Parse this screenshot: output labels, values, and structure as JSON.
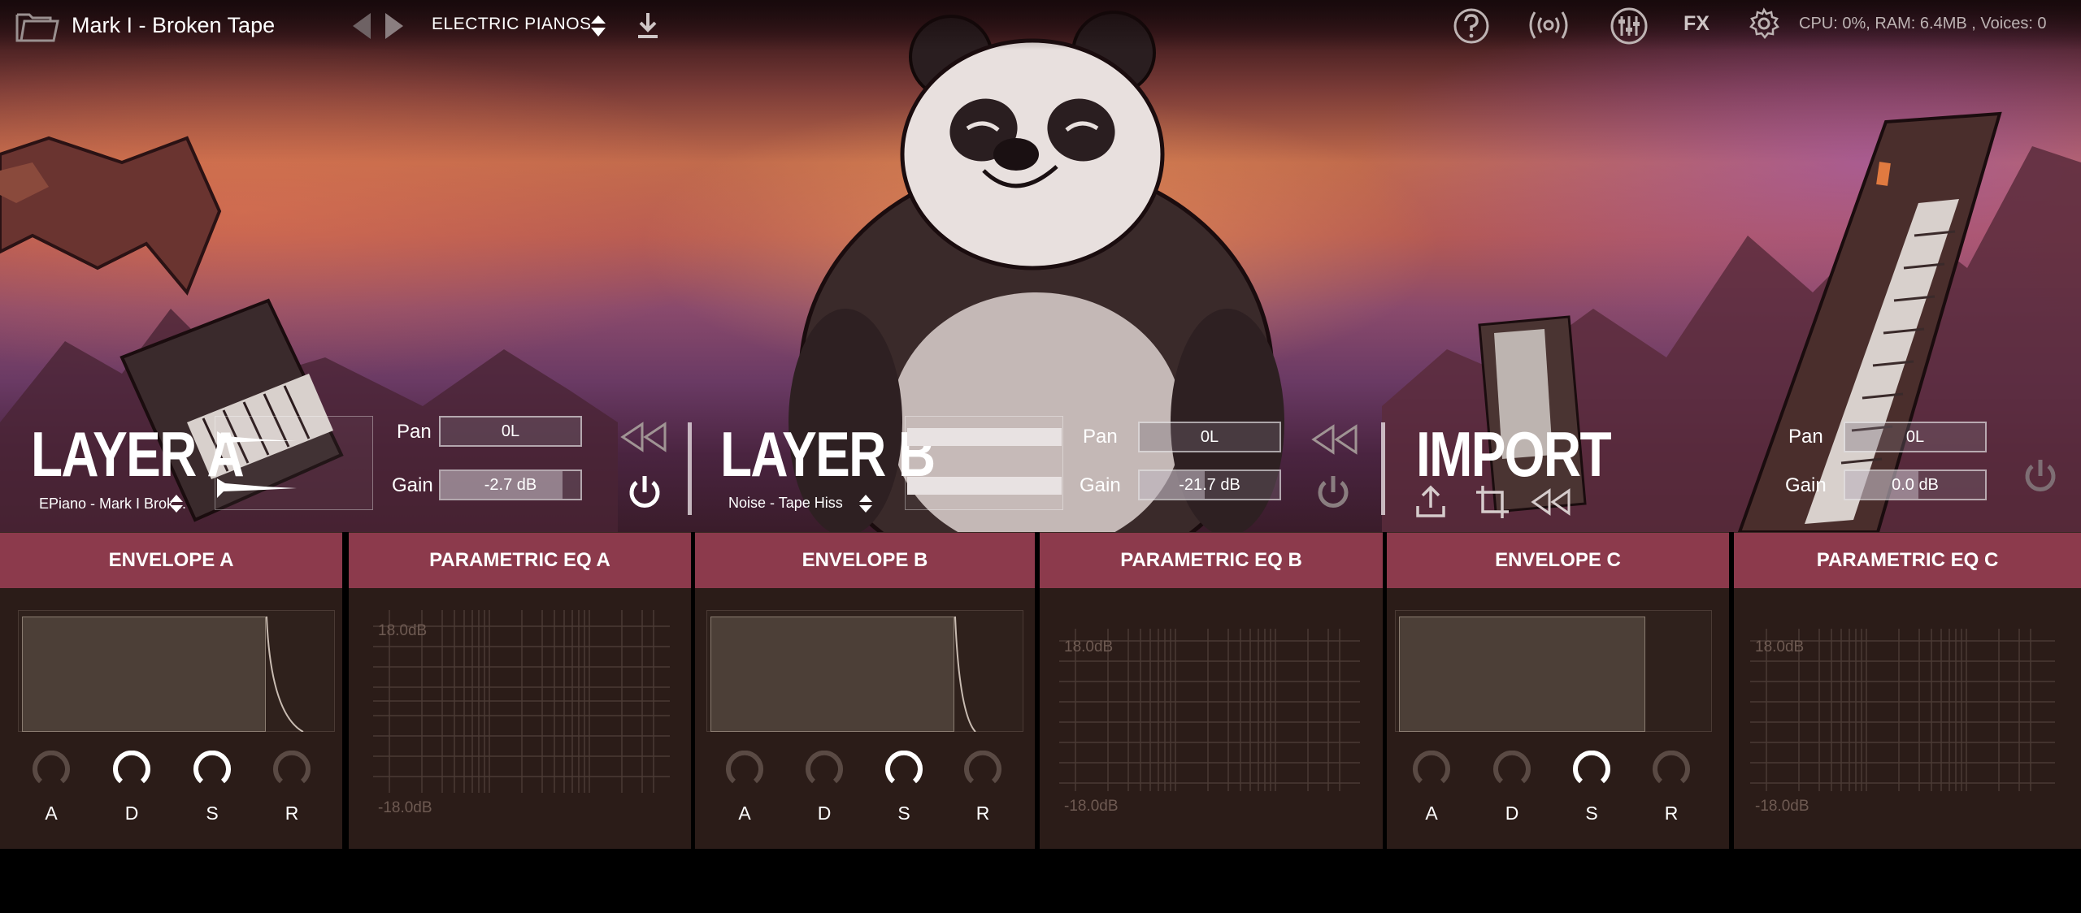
{
  "top_bar": {
    "preset_name": "Mark I - Broken Tape",
    "bank_name": "ELECTRIC PIANOS",
    "fx_label": "FX",
    "stats": "CPU: 0%, RAM: 6.4MB , Voices: 0",
    "icons": [
      "folder-icon",
      "prev-arrow-icon",
      "next-arrow-icon",
      "bank-updown-icon",
      "download-icon",
      "help-icon",
      "broadcast-icon",
      "mixer-icon",
      "fx-icon",
      "gear-icon"
    ]
  },
  "layer_a": {
    "title": "LAYER A",
    "sample": "EPiano - Mark I Brok...",
    "pan_label": "Pan",
    "pan_value": "0L",
    "gain_label": "Gain",
    "gain_value": "-2.7 dB"
  },
  "layer_b": {
    "title": "LAYER B",
    "sample": "Noise - Tape Hiss",
    "pan_label": "Pan",
    "pan_value": "0L",
    "gain_label": "Gain",
    "gain_value": "-21.7 dB"
  },
  "import": {
    "title": "IMPORT",
    "pan_label": "Pan",
    "pan_value": "0L",
    "gain_label": "Gain",
    "gain_value": "0.0 dB"
  },
  "panels": [
    {
      "title": "ENVELOPE A",
      "type": "envelope",
      "knobs": [
        "A",
        "D",
        "S",
        "R"
      ],
      "active_knobs": [
        false,
        true,
        true,
        false
      ]
    },
    {
      "title": "PARAMETRIC EQ A",
      "type": "eq",
      "top_label": "18.0dB",
      "bottom_label": "-18.0dB"
    },
    {
      "title": "ENVELOPE B",
      "type": "envelope",
      "knobs": [
        "A",
        "D",
        "S",
        "R"
      ],
      "active_knobs": [
        false,
        false,
        true,
        false
      ]
    },
    {
      "title": "PARAMETRIC EQ B",
      "type": "eq",
      "top_label": "18.0dB",
      "bottom_label": "-18.0dB"
    },
    {
      "title": "ENVELOPE C",
      "type": "envelope",
      "knobs": [
        "A",
        "D",
        "S",
        "R"
      ],
      "active_knobs": [
        false,
        false,
        true,
        false
      ]
    },
    {
      "title": "PARAMETRIC EQ C",
      "type": "eq",
      "top_label": "18.0dB",
      "bottom_label": "-18.0dB"
    }
  ],
  "colors": {
    "panel_header": "#8c3a4c",
    "panel_bg": "#2b1c18",
    "knob_active": "#ffffff",
    "knob_inactive": "#5a4a44"
  }
}
